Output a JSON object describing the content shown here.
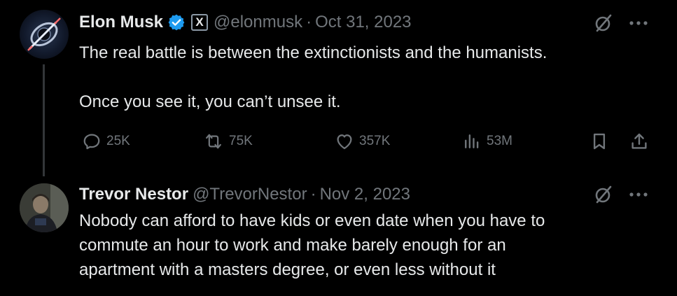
{
  "tweets": [
    {
      "author_name": "Elon Musk",
      "verified_icon": "verified-badge-icon",
      "affiliation_icon": "x-logo-icon",
      "affiliation_label": "X",
      "handle": "@elonmusk",
      "separator": "·",
      "date": "Oct 31, 2023",
      "text": "The real battle is between the extinctionists and the humanists.\n\nOnce you see it, you can’t unsee it.",
      "stats": {
        "replies": "25K",
        "reposts": "75K",
        "likes": "357K",
        "views": "53M"
      }
    },
    {
      "author_name": "Trevor Nestor",
      "handle": "@TrevorNestor",
      "separator": "·",
      "date": "Nov 2, 2023",
      "text": "Nobody can afford to have kids or even date when you have to\ncommute an hour to work and make barely enough for an\napartment with a masters degree, or even less without it"
    }
  ],
  "colors": {
    "background": "#000000",
    "text_primary": "#e7e9ea",
    "text_secondary": "#71767b",
    "verified_blue": "#1d9bf0",
    "thread_line": "#333639"
  }
}
